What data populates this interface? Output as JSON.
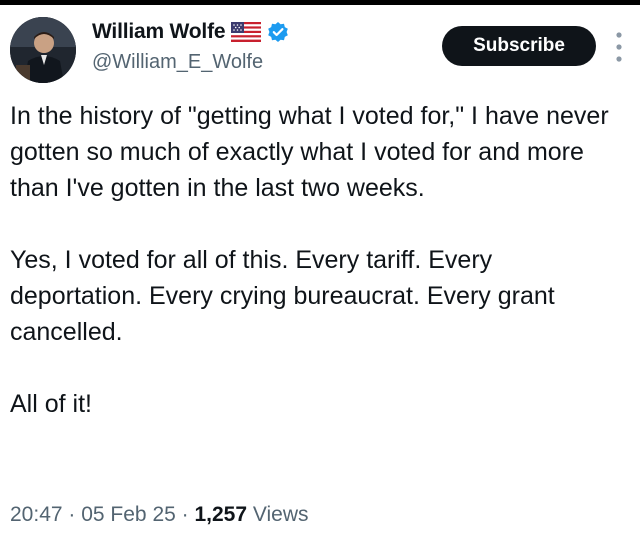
{
  "author": {
    "display_name": "William Wolfe",
    "handle": "@William_E_Wolfe",
    "badges": [
      "us-flag-icon",
      "verified-icon"
    ],
    "verified_color": "#1d9bf0"
  },
  "actions": {
    "subscribe_label": "Subscribe",
    "more_icon": "more-vertical-icon"
  },
  "tweet": {
    "paragraphs": [
      "In the history of \"getting what I voted for,\" I have never gotten so much of exactly what I voted for and more than I've gotten in the last two weeks.",
      "Yes, I voted for all of this. Every tariff. Every deportation. Every crying bureaucrat. Every grant cancelled.",
      "All of it!"
    ]
  },
  "meta": {
    "time": "20:47",
    "sep1": " · ",
    "date": "05 Feb 25",
    "sep2": " · ",
    "views_count": "1,257",
    "views_label": " Views"
  }
}
